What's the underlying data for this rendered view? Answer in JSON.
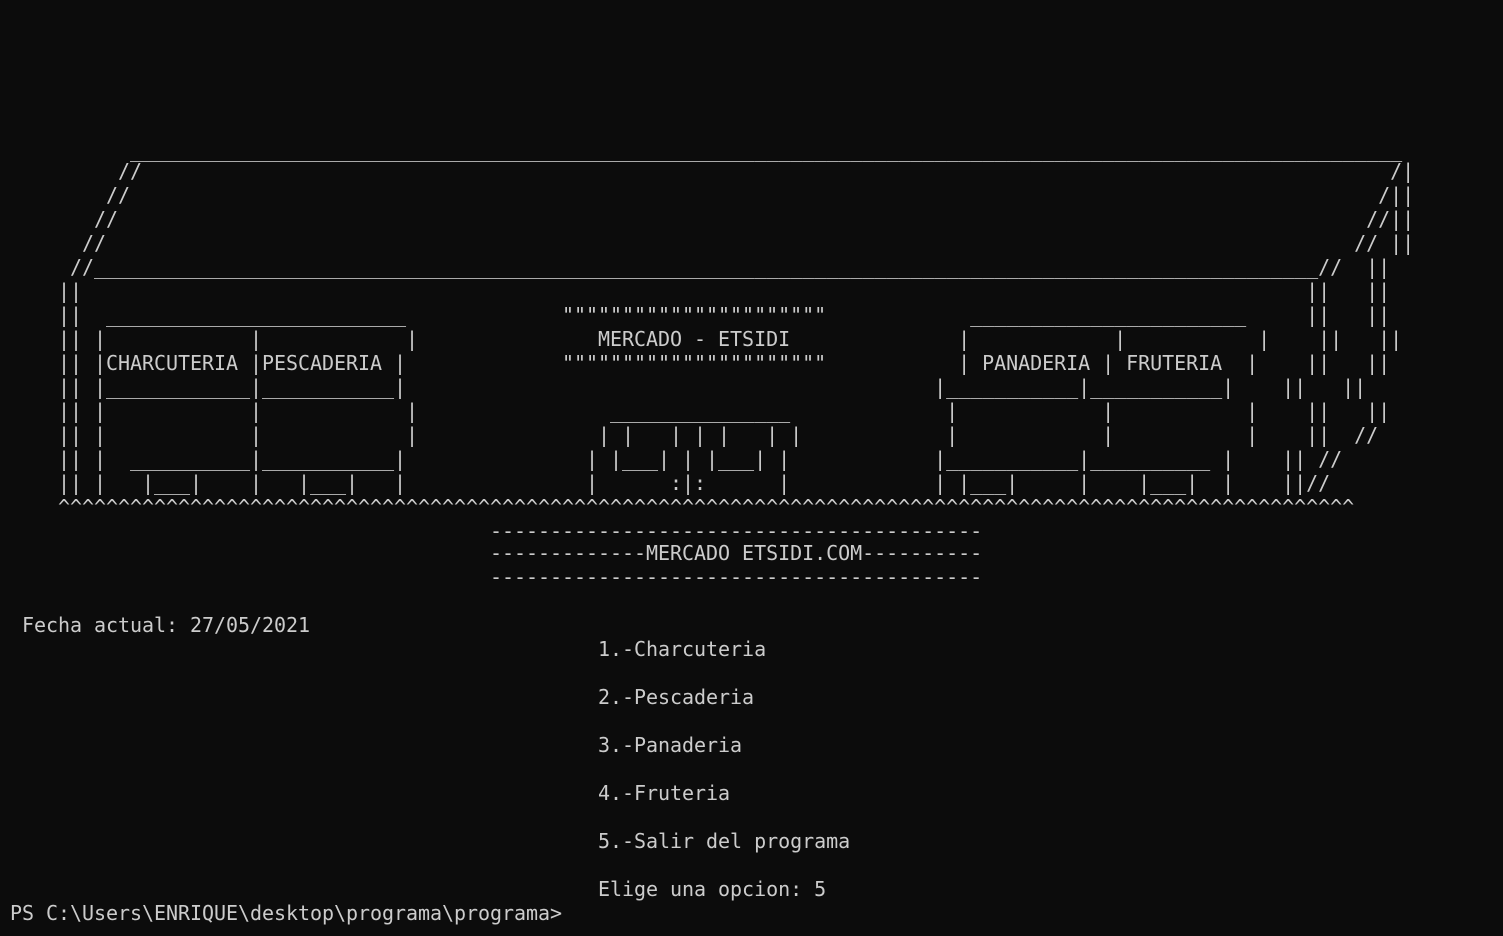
{
  "terminal": {
    "ascii_art": [
      "          __________________________________________________________________________________________________________",
      "         //                                                                                                        /|",
      "        //                                                                                                        /||",
      "       //                                                                                                        //||",
      "      //                                                                                                        // ||",
      "     //______________________________________________________________________________________________________//  ||",
      "    ||                                                                                                      ||   ||",
      "    ||  _________________________             \"\"\"\"\"\"\"\"\"\"\"\"\"\"\"\"\"\"\"\"\"\"            _______________________     ||   ||",
      "    || |            |            |               MERCADO - ETSIDI              |            |           |    ||   ||",
      "    || |CHARCUTERIA |PESCADERIA |             \"\"\"\"\"\"\"\"\"\"\"\"\"\"\"\"\"\"\"\"\"\"           | PANADERIA | FRUTERIA  |    ||   ||",
      "    || |____________|___________|                                            |___________|___________|    ||   ||",
      "    || |            |            |                _______________             |            |           |    ||   ||",
      "    || |            |            |               | |   | | |   | |            |            |           |    ||  //",
      "    || |  __________|___________|               | |___| | |___| |            |___________|__________ |    || //",
      "    || |   |___|    |   |___|   |               |      :|:      |            | |___|     |    |___|  |    ||//",
      "    ^^^^^^^^^^^^^^^^^^^^^^^^^^^^^^^^^^^^^^^^^^^^^^^^^^^^^^^^^^^^^^^^^^^^^^^^^^^^^^^^^^^^^^^^^^^^^^^^^^^^^^^^^^^^",
      "                                        -----------------------------------------",
      "                                        -------------MERCADO ETSIDI.COM----------",
      "                                        -----------------------------------------"
    ],
    "date_line": " Fecha actual: 27/05/2021",
    "menu": [
      "                                                 1.-Charcuteria",
      "                                                 2.-Pescaderia",
      "                                                 3.-Panaderia",
      "                                                 4.-Fruteria",
      "                                                 5.-Salir del programa"
    ],
    "prompt_choice": "                                                 Elige una opcion: 5",
    "shell_prompt": "PS C:\\Users\\ENRIQUE\\desktop\\programa\\programa>"
  },
  "colors": {
    "background": "#0c0c0c",
    "foreground": "#cccccc"
  }
}
